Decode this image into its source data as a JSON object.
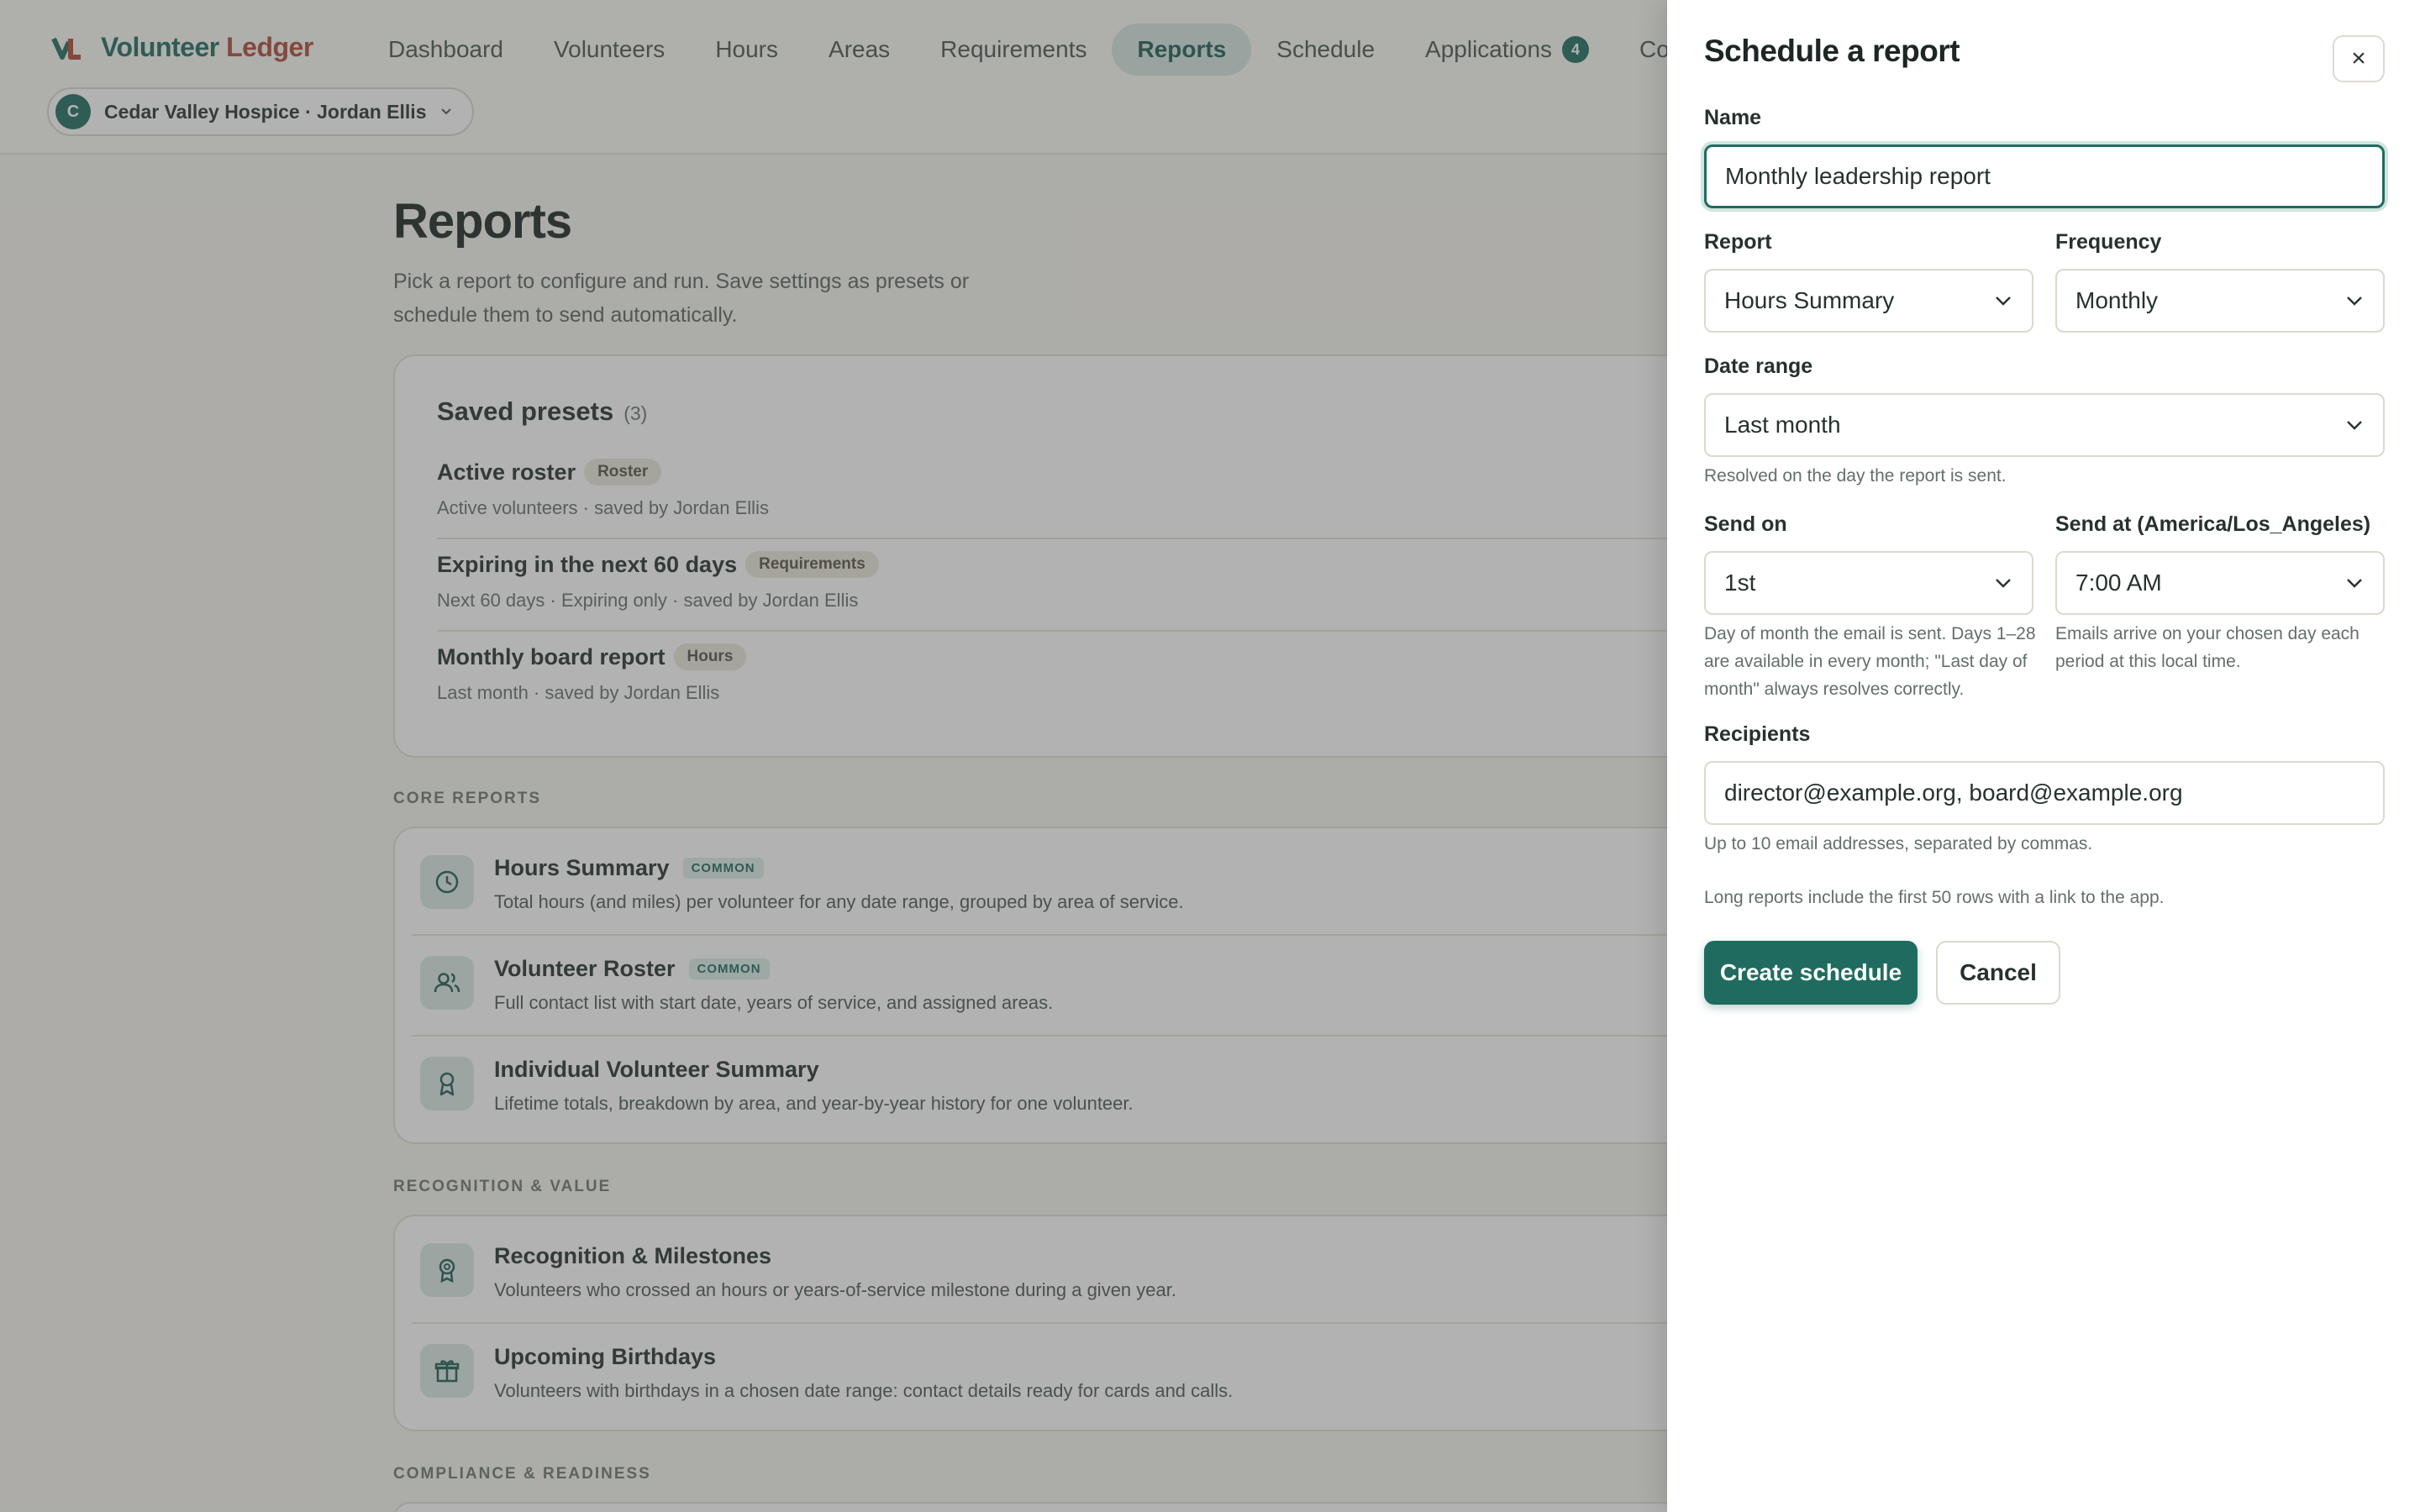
{
  "brand": {
    "name_a": "Volunteer",
    "name_b": "Ledger"
  },
  "nav": {
    "items": [
      {
        "label": "Dashboard"
      },
      {
        "label": "Volunteers"
      },
      {
        "label": "Hours"
      },
      {
        "label": "Areas"
      },
      {
        "label": "Requirements"
      },
      {
        "label": "Reports"
      },
      {
        "label": "Schedule"
      },
      {
        "label": "Applications",
        "badge": "4"
      },
      {
        "label": "Commu"
      }
    ],
    "active": "Reports"
  },
  "org": {
    "avatar": "C",
    "label": "Cedar Valley Hospice · Jordan Ellis"
  },
  "page": {
    "title": "Reports",
    "subtitle": "Pick a report to configure and run. Save settings as presets or schedule them to send automatically."
  },
  "presets": {
    "heading": "Saved presets",
    "count": "(3)",
    "items": [
      {
        "title": "Active roster",
        "tag": "Roster",
        "meta": "Active volunteers · saved by Jordan Ellis"
      },
      {
        "title": "Expiring in the next 60 days",
        "tag": "Requirements",
        "meta": "Next 60 days · Expiring only · saved by Jordan Ellis"
      },
      {
        "title": "Monthly board report",
        "tag": "Hours",
        "meta": "Last month · saved by Jordan Ellis"
      }
    ]
  },
  "sections": {
    "core": "CORE REPORTS",
    "recognition": "RECOGNITION & VALUE",
    "compliance": "COMPLIANCE & READINESS"
  },
  "core_reports": [
    {
      "title": "Hours Summary",
      "common": "COMMON",
      "desc": "Total hours (and miles) per volunteer for any date range, grouped by area of service.",
      "icon": "clock-icon"
    },
    {
      "title": "Volunteer Roster",
      "common": "COMMON",
      "desc": "Full contact list with start date, years of service, and assigned areas.",
      "icon": "users-icon"
    },
    {
      "title": "Individual Volunteer Summary",
      "desc": "Lifetime totals, breakdown by area, and year-by-year history for one volunteer.",
      "icon": "award-icon"
    }
  ],
  "recognition_reports": [
    {
      "title": "Recognition & Milestones",
      "desc": "Volunteers who crossed an hours or years-of-service milestone during a given year.",
      "icon": "medal-icon"
    },
    {
      "title": "Upcoming Birthdays",
      "desc": "Volunteers with birthdays in a chosen date range: contact details ready for cards and calls.",
      "icon": "gift-icon"
    }
  ],
  "drawer": {
    "title": "Schedule a report",
    "close": "×",
    "name_label": "Name",
    "name_value": "Monthly leadership report",
    "report_label": "Report",
    "report_value": "Hours Summary",
    "frequency_label": "Frequency",
    "frequency_value": "Monthly",
    "range_label": "Date range",
    "range_value": "Last month",
    "range_help": "Resolved on the day the report is sent.",
    "send_on_label": "Send on",
    "send_on_value": "1st",
    "send_on_help": "Day of month the email is sent. Days 1–28 are available in every month; \"Last day of month\" always resolves correctly.",
    "send_at_label": "Send at (America/Los_Angeles)",
    "send_at_value": "7:00 AM",
    "send_at_help": "Emails arrive on your chosen day each period at this local time.",
    "recipients_label": "Recipients",
    "recipients_value": "director@example.org, board@example.org",
    "recipients_help": "Up to 10 email addresses, separated by commas.",
    "long_help": "Long reports include the first 50 rows with a link to the app.",
    "create": "Create schedule",
    "cancel": "Cancel"
  },
  "colors": {
    "accent": "#1f6b5f",
    "brand_secondary": "#b04a3a"
  }
}
